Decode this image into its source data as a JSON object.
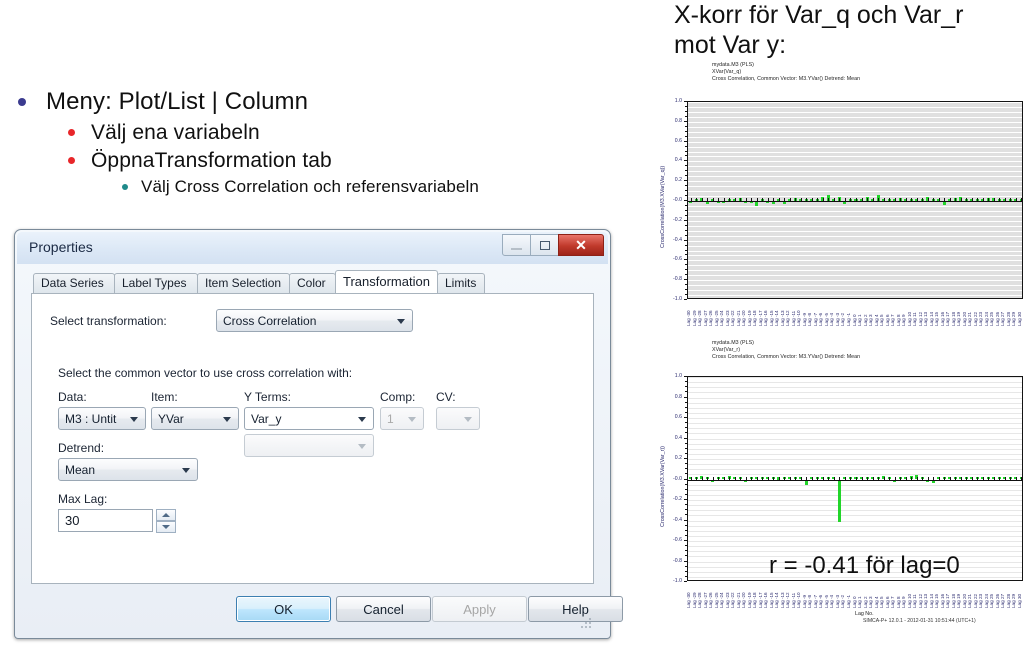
{
  "slide": {
    "bullets": [
      {
        "level": 1,
        "text": "Meny: Plot/List | Column"
      },
      {
        "level": 2,
        "text": "Välj ena variabeln"
      },
      {
        "level": 2,
        "text": "ÖppnaTransformation tab"
      },
      {
        "level": 3,
        "text": "Välj Cross Correlation och referensvariabeln"
      }
    ],
    "bullet_colors": {
      "level1": "#3b3b8f",
      "level2": "#e8262a",
      "level3": "#1f8a8a"
    }
  },
  "dialog": {
    "title": "Properties",
    "window_controls": {
      "minimize": "Minimize",
      "restore": "Restore",
      "close": "Close"
    },
    "tabs": [
      {
        "label": "Data Series",
        "active": false
      },
      {
        "label": "Label Types",
        "active": false
      },
      {
        "label": "Item Selection",
        "active": false
      },
      {
        "label": "Color",
        "active": false
      },
      {
        "label": "Transformation",
        "active": true
      },
      {
        "label": "Limits",
        "active": false
      }
    ],
    "select_transformation_label": "Select transformation:",
    "transformation_value": "Cross Correlation",
    "common_vector_label": "Select the common vector to use cross correlation with:",
    "fields": {
      "data_label": "Data:",
      "data_value": "M3 : Untit",
      "item_label": "Item:",
      "item_value": "YVar",
      "yterms_label": "Y Terms:",
      "yterms_value": "Var_y",
      "yterms_value2": "",
      "comp_label": "Comp:",
      "comp_value": "1",
      "cv_label": "CV:",
      "cv_value": "",
      "detrend_label": "Detrend:",
      "detrend_value": "Mean",
      "maxlag_label": "Max Lag:",
      "maxlag_value": "30"
    },
    "buttons": {
      "ok": "OK",
      "cancel": "Cancel",
      "apply": "Apply",
      "help": "Help"
    }
  },
  "right": {
    "heading_line1": "X-korr för Var_q  och Var_r",
    "heading_line2": "mot Var  y:"
  },
  "chart_data": [
    {
      "type": "bar",
      "id": "chart-1",
      "title": "mydata.M3 (PLS)\nXVar(Var_q)\nCross Correlation, Common Vector: M3.YVar() Detrend: Mean",
      "ylabel": "CrossCorrelation(M3.XVar(Var_q))",
      "xlabel": "",
      "ylim": [
        -1.0,
        1.0
      ],
      "yticks": [
        "1.0",
        "0.8",
        "0.6",
        "0.4",
        "0.2",
        "-0.0",
        "-0.2",
        "-0.4",
        "-0.6",
        "-0.8",
        "-1.0"
      ],
      "grid": true,
      "plot_background": "#e0e0e0",
      "bar_color": "#22d52a",
      "legend": "none",
      "categories": [
        -30,
        -29,
        -28,
        -27,
        -26,
        -25,
        -24,
        -23,
        -22,
        -21,
        -20,
        -19,
        -18,
        -17,
        -16,
        -15,
        -14,
        -13,
        -12,
        -11,
        -10,
        -9,
        -8,
        -7,
        -6,
        -5,
        -4,
        -3,
        -2,
        -1,
        0,
        1,
        2,
        3,
        4,
        5,
        6,
        7,
        8,
        9,
        10,
        11,
        12,
        13,
        14,
        15,
        16,
        17,
        18,
        19,
        20,
        21,
        22,
        23,
        24,
        25,
        26,
        27,
        28,
        29,
        30
      ],
      "values": [
        -0.01,
        0.005,
        0.035,
        -0.035,
        0.0,
        -0.025,
        -0.022,
        0.0,
        0.008,
        0.028,
        -0.005,
        -0.01,
        -0.055,
        0.0,
        -0.005,
        -0.03,
        0.0,
        -0.035,
        0.012,
        0.028,
        0.0,
        0.018,
        0.008,
        0.0,
        0.045,
        0.058,
        0.02,
        0.04,
        -0.03,
        0.0,
        0.012,
        0.022,
        0.045,
        0.012,
        0.058,
        0.0,
        0.012,
        0.008,
        0.026,
        0.0,
        0.005,
        0.018,
        0.0,
        0.042,
        0.008,
        0.01,
        -0.04,
        0.015,
        0.028,
        0.038,
        0.02,
        0.005,
        0.012,
        0.018,
        0.03,
        0.03,
        0.012,
        0.006,
        0.018,
        0.01,
        0.008
      ]
    },
    {
      "type": "bar",
      "id": "chart-2",
      "title": "mydata.M3 (PLS)\nXVar(Var_r)\nCross Correlation, Common Vector: M3.YVar() Detrend: Mean",
      "ylabel": "CrossCorrelation(M3.XVar(Var_r))",
      "xlabel": "Lag No.",
      "ylim": [
        -1.0,
        1.0
      ],
      "yticks": [
        "1.0",
        "0.8",
        "0.6",
        "0.4",
        "0.2",
        "-0.0",
        "-0.2",
        "-0.4",
        "-0.6",
        "-0.8",
        "-1.0"
      ],
      "grid": true,
      "plot_background": "#ffffff",
      "bar_color": "#22d52a",
      "legend": "none",
      "annotation": "r = -0.41 för lag=0",
      "footer": "SIMCA-P+ 12.0.1 - 2012-01-31 10:51:44 (UTC+1)",
      "categories": [
        -30,
        -29,
        -28,
        -27,
        -26,
        -25,
        -24,
        -23,
        -22,
        -21,
        -20,
        -19,
        -18,
        -17,
        -16,
        -15,
        -14,
        -13,
        -12,
        -11,
        -10,
        -9,
        -8,
        -7,
        -6,
        -5,
        -4,
        -3,
        -2,
        -1,
        0,
        1,
        2,
        3,
        4,
        5,
        6,
        7,
        8,
        9,
        10,
        11,
        12,
        13,
        14,
        15,
        16,
        17,
        18,
        19,
        20,
        21,
        22,
        23,
        24,
        25,
        26,
        27,
        28,
        29,
        30
      ],
      "values": [
        0.008,
        0.022,
        0.035,
        0.0,
        -0.018,
        0.0,
        0.012,
        0.03,
        0.0,
        0.005,
        -0.008,
        0.0,
        0.012,
        0.02,
        0.0,
        0.008,
        0.025,
        0.012,
        0.0,
        0.018,
        0.0,
        -0.055,
        0.0,
        0.012,
        0.018,
        0.0,
        0.02,
        -0.41,
        0.0,
        0.01,
        0.018,
        0.0,
        0.012,
        0.008,
        0.0,
        0.03,
        0.012,
        -0.015,
        0.0,
        0.008,
        0.03,
        0.045,
        0.0,
        -0.025,
        -0.03,
        0.0,
        0.006,
        0.012,
        0.004,
        0.0,
        0.01,
        0.018,
        0.012,
        0.0,
        0.02,
        0.014,
        0.008,
        0.016,
        0.01,
        0.018,
        0.012
      ]
    }
  ]
}
